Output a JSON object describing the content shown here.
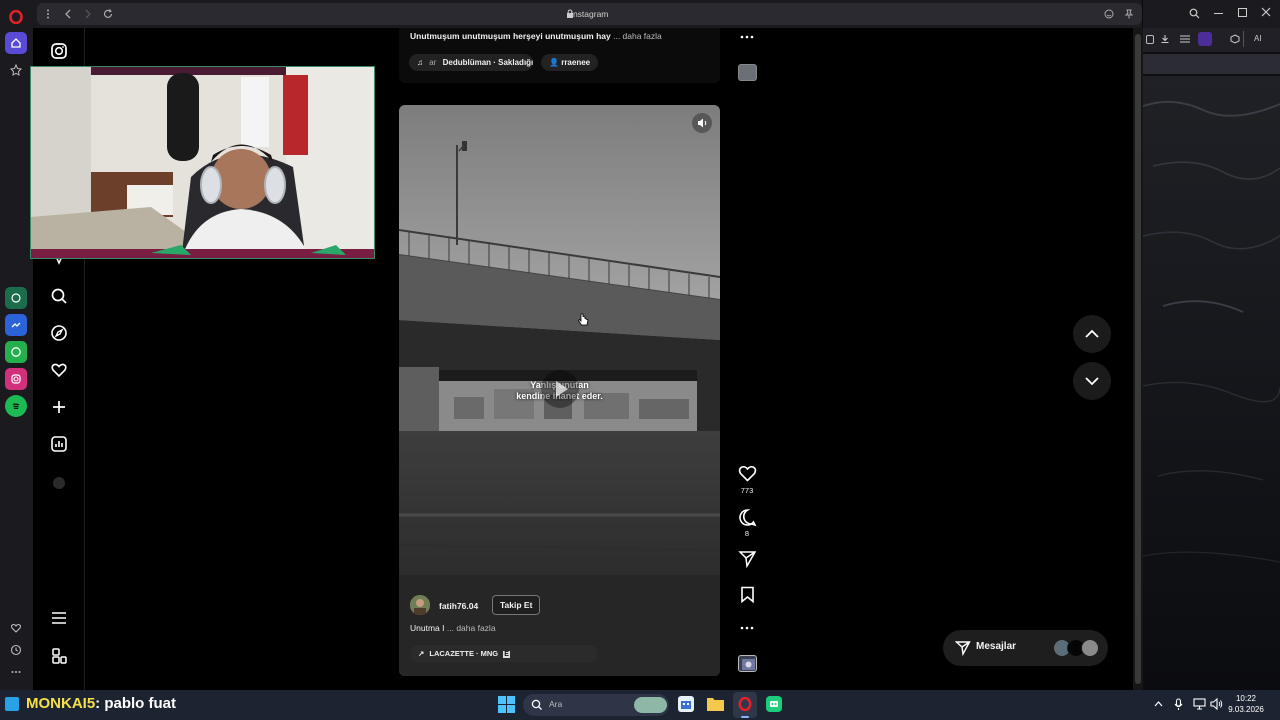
{
  "browser": {
    "address_title": "Instagram",
    "right_tab_label": "AI"
  },
  "previous_post": {
    "caption": "Unutmuşum unutmuşum herşeyi unutmuşum hay",
    "more_label": "... daha fazla",
    "audio_prefix": "ar",
    "audio": "Dedublüman · Sakladığı",
    "user_tag": "rraenee"
  },
  "reel": {
    "overlay_line1": "Yanlış unutan",
    "overlay_line2": "kendine ihanet eder.",
    "username": "fatih76.04",
    "follow_label": "Takip Et",
    "caption": "Unutma I",
    "more_label": "... daha fazla",
    "audio": "LACAZETTE · MNG"
  },
  "actions": {
    "likes": "773",
    "comments": "8"
  },
  "messages": {
    "label": "Mesajlar"
  },
  "stream_overlay": {
    "channel": "MONKAI5",
    "text": ": pablo fuat"
  },
  "taskbar": {
    "search_placeholder": "Ara",
    "time": "10:22",
    "date": "9.03.2026"
  },
  "colors": {
    "opera_red": "#e0202b",
    "taskbar": "#1c2432",
    "follow_bg": "#1f1f1f"
  }
}
